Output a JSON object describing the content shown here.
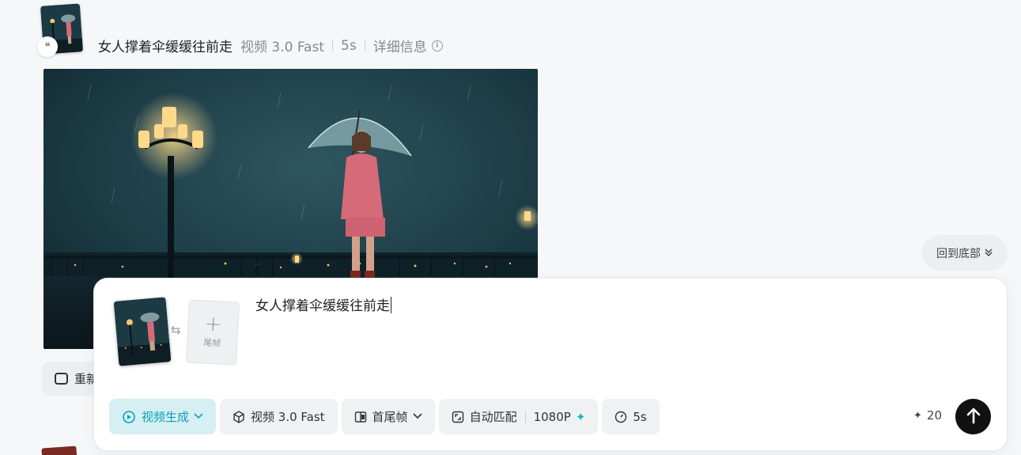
{
  "record": {
    "prompt": "女人撑着伞缓缓往前走",
    "model": "视频 3.0 Fast",
    "duration": "5s",
    "details_label": "详细信息",
    "quote_glyph": "❝"
  },
  "regenerate": {
    "label": "重新"
  },
  "back_to_bottom": {
    "label": "回到底部",
    "icon": "double-chevron-down-icon"
  },
  "composer": {
    "prompt_text": "女人撑着伞缓缓往前走",
    "last_frame_label": "尾帧",
    "toolbar": {
      "mode_label": "视频生成",
      "model_label": "视频 3.0 Fast",
      "frame_mode_label": "首尾帧",
      "ratio_label": "自动匹配",
      "resolution_label": "1080P",
      "duration_label": "5s"
    },
    "credits": "20"
  },
  "colors": {
    "accent": "#0aa1b8",
    "accent_bg": "#d6eff3",
    "send_button": "#111111",
    "background": "#f6f7f9"
  }
}
